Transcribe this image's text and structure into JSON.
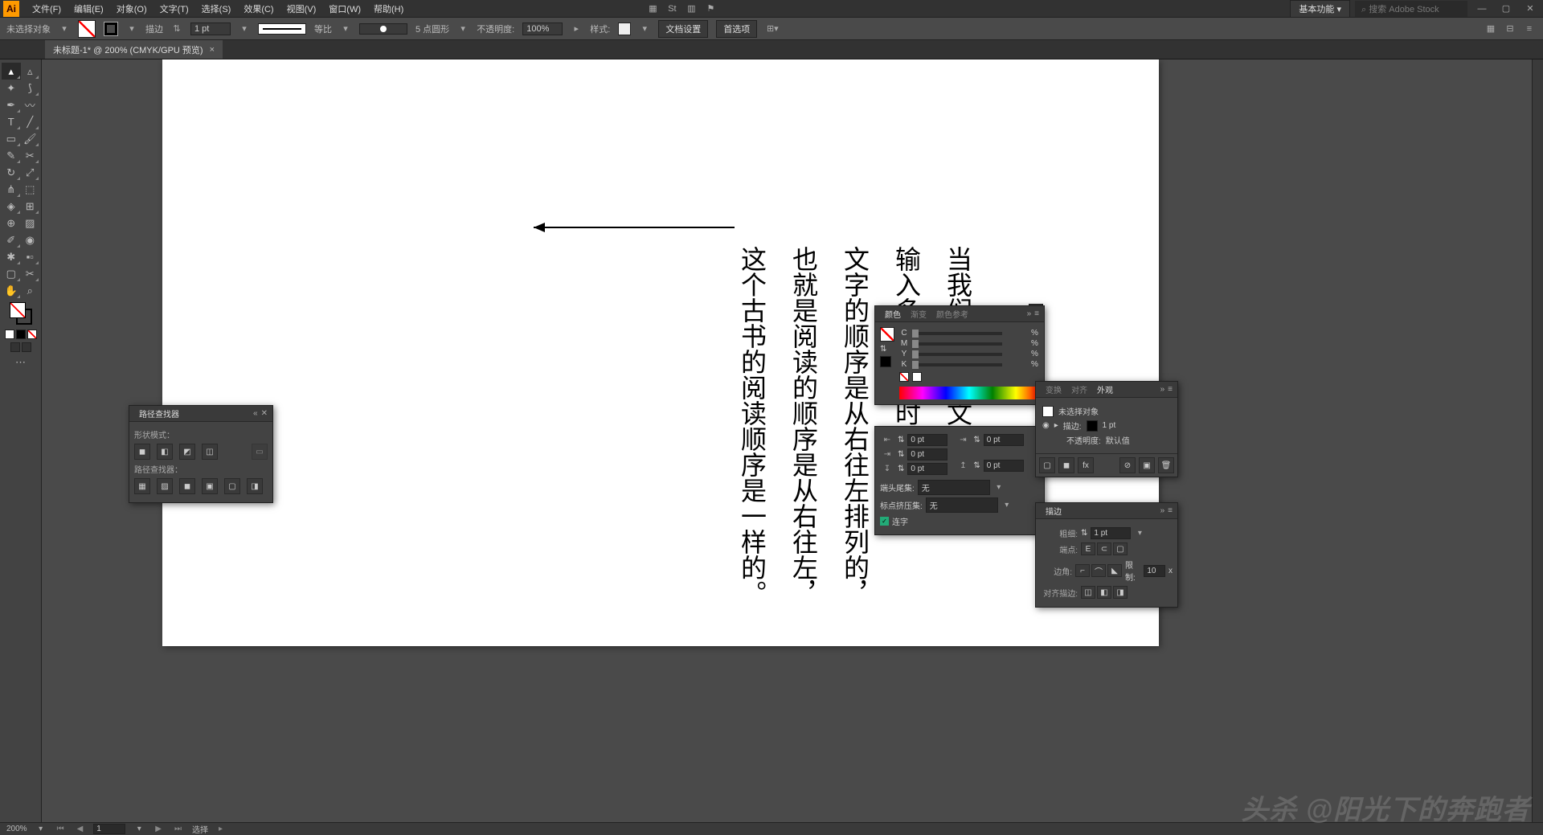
{
  "app": {
    "logo": "Ai"
  },
  "menubar": {
    "items": [
      "文件(F)",
      "编辑(E)",
      "对象(O)",
      "文字(T)",
      "选择(S)",
      "效果(C)",
      "视图(V)",
      "窗口(W)",
      "帮助(H)"
    ],
    "workspace": "基本功能",
    "search_placeholder": "搜索 Adobe Stock"
  },
  "ctrlbar": {
    "no_selection": "未选择对象",
    "stroke_label": "描边",
    "stroke_value": "1 pt",
    "uniform": "等比",
    "brush_value": "5 点圆形",
    "opacity_label": "不透明度:",
    "opacity_value": "100%",
    "style_label": "样式:",
    "doc_setup": "文档设置",
    "prefs": "首选项"
  },
  "tab": {
    "label": "未标题-1* @ 200% (CMYK/GPU 预览)",
    "close": "×"
  },
  "artboard": {
    "columns": [
      "当我们用直排文字工具",
      "输入多列文字时，",
      "文字的顺序是从右往左排列的，",
      "也就是阅读的顺序是从右往左，",
      "这个古书的阅读顺序是一样的。"
    ]
  },
  "pathfinder": {
    "title": "路径查找器",
    "shape_modes": "形状模式：",
    "pf_label": "路径查找器："
  },
  "color": {
    "title": "颜色",
    "gradient": "渐变",
    "guide": "颜色参考",
    "channels": [
      {
        "l": "C",
        "v": "",
        "p": "%"
      },
      {
        "l": "M",
        "v": "",
        "p": "%"
      },
      {
        "l": "Y",
        "v": "",
        "p": "%"
      },
      {
        "l": "K",
        "v": "",
        "p": "%"
      }
    ]
  },
  "character": {
    "v1": "0 pt",
    "v2": "0 pt",
    "v3": "0 pt",
    "v4": "0 pt",
    "v5": "0 pt",
    "cap_label": "端头尾集:",
    "cap_value": "无",
    "punct_label": "标点挤压集:",
    "punct_value": "无",
    "lig": "连字"
  },
  "transform": {
    "title": "变换",
    "align": "对齐",
    "appearance": "外观",
    "no_sel": "未选择对象",
    "stroke": "描边:",
    "stroke_v": "1 pt",
    "opacity": "不透明度:",
    "opacity_v": "默认值"
  },
  "stroke": {
    "title": "描边",
    "weight": "粗细:",
    "weight_v": "1 pt",
    "caps": "端点:",
    "corner": "边角:",
    "limit": "限制:",
    "limit_v": "10",
    "x": "x",
    "align": "对齐描边:"
  },
  "status": {
    "zoom": "200%",
    "page": "1",
    "tool": "选择"
  },
  "watermark": "头杀 @阳光下的奔跑者"
}
